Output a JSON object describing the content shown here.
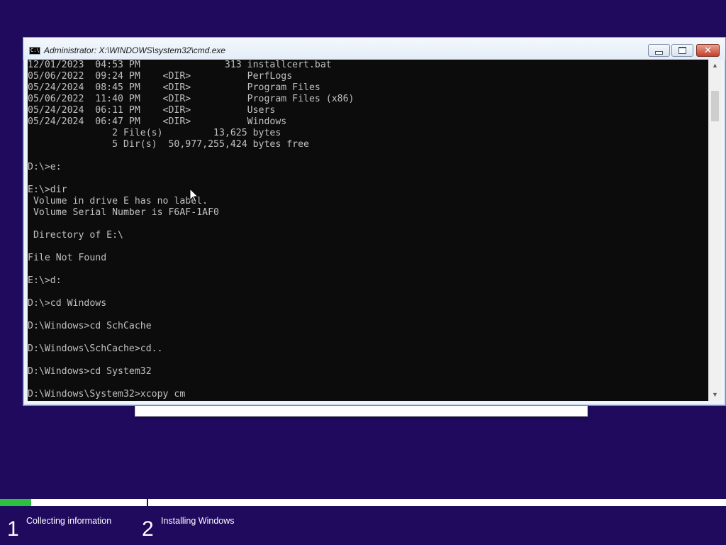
{
  "window": {
    "title": "Administrator: X:\\WINDOWS\\system32\\cmd.exe",
    "icon_label": "C:\\."
  },
  "console": {
    "lines": [
      "12/01/2023  04:53 PM               313 installcert.bat",
      "05/06/2022  09:24 PM    <DIR>          PerfLogs",
      "05/24/2024  08:45 PM    <DIR>          Program Files",
      "05/06/2022  11:40 PM    <DIR>          Program Files (x86)",
      "05/24/2024  06:11 PM    <DIR>          Users",
      "05/24/2024  06:47 PM    <DIR>          Windows",
      "               2 File(s)         13,625 bytes",
      "               5 Dir(s)  50,977,255,424 bytes free",
      "",
      "D:\\>e:",
      "",
      "E:\\>dir",
      " Volume in drive E has no label.",
      " Volume Serial Number is F6AF-1AF0",
      "",
      " Directory of E:\\",
      "",
      "File Not Found",
      "",
      "E:\\>d:",
      "",
      "D:\\>cd Windows",
      "",
      "D:\\Windows>cd SchCache",
      "",
      "D:\\Windows\\SchCache>cd..",
      "",
      "D:\\Windows>cd System32",
      "",
      "D:\\Windows\\System32>xcopy cm"
    ]
  },
  "setup": {
    "progress_fraction": 0.21,
    "step1_fraction": 0.043,
    "steps": [
      {
        "number": "1",
        "label": "Collecting information"
      },
      {
        "number": "2",
        "label": "Installing Windows"
      }
    ]
  },
  "colors": {
    "background": "#1f0a5e",
    "progress": "#2ebf40",
    "console_bg": "#0c0c0c",
    "console_text": "#c0c0c0"
  },
  "icons": {
    "minimize": "minimize-icon",
    "maximize": "maximize-icon",
    "close": "close-icon",
    "scroll_up": "chevron-up-icon",
    "scroll_down": "chevron-down-icon",
    "pointer": "mouse-pointer-icon"
  }
}
